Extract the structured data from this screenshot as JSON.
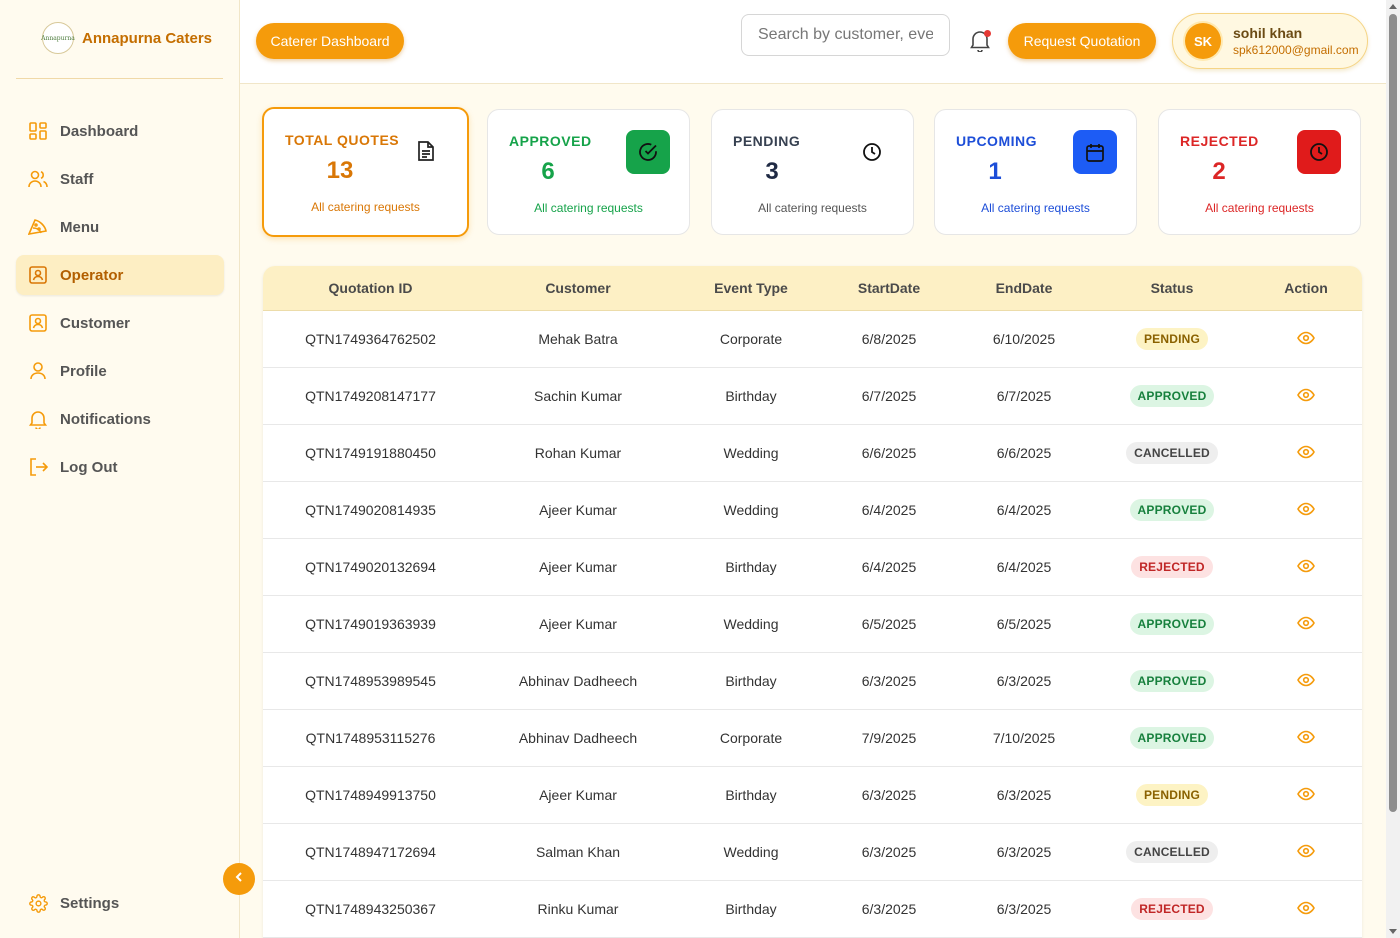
{
  "brand": {
    "name": "Annapurna Caters",
    "logo_text": "Annapurna"
  },
  "sidebar": {
    "items": [
      {
        "label": "Dashboard",
        "icon": "grid-icon"
      },
      {
        "label": "Staff",
        "icon": "users-icon"
      },
      {
        "label": "Menu",
        "icon": "pizza-icon"
      },
      {
        "label": "Operator",
        "icon": "id-card-icon",
        "active": true
      },
      {
        "label": "Customer",
        "icon": "id-card-icon"
      },
      {
        "label": "Profile",
        "icon": "user-icon"
      },
      {
        "label": "Notifications",
        "icon": "bell-icon"
      },
      {
        "label": "Log Out",
        "icon": "logout-icon"
      }
    ],
    "settings_label": "Settings"
  },
  "header": {
    "dashboard_button": "Caterer Dashboard",
    "search_placeholder": "Search by customer, event",
    "request_button": "Request Quotation",
    "user": {
      "initials": "SK",
      "name": "sohil khan",
      "email": "spk612000@gmail.com"
    }
  },
  "stats": [
    {
      "title": "TOTAL QUOTES",
      "value": "13",
      "sub": "All catering requests",
      "color": "#d97706",
      "icon": "document-icon"
    },
    {
      "title": "APPROVED",
      "value": "6",
      "sub": "All catering requests",
      "color": "#16a34a",
      "icon": "check-circle-icon"
    },
    {
      "title": "PENDING",
      "value": "3",
      "sub": "All catering requests",
      "color": "#374151",
      "icon": "clock-icon"
    },
    {
      "title": "UPCOMING",
      "value": "1",
      "sub": "All catering requests",
      "color": "#1d4ed8",
      "icon": "calendar-icon"
    },
    {
      "title": "REJECTED",
      "value": "2",
      "sub": "All catering requests",
      "color": "#dc2626",
      "icon": "clock-icon"
    }
  ],
  "table": {
    "columns": [
      "Quotation ID",
      "Customer",
      "Event Type",
      "StartDate",
      "EndDate",
      "Status",
      "Action"
    ],
    "rows": [
      {
        "id": "QTN1749364762502",
        "customer": "Mehak Batra",
        "event": "Corporate",
        "start": "6/8/2025",
        "end": "6/10/2025",
        "status": "PENDING"
      },
      {
        "id": "QTN1749208147177",
        "customer": "Sachin Kumar",
        "event": "Birthday",
        "start": "6/7/2025",
        "end": "6/7/2025",
        "status": "APPROVED"
      },
      {
        "id": "QTN1749191880450",
        "customer": "Rohan Kumar",
        "event": "Wedding",
        "start": "6/6/2025",
        "end": "6/6/2025",
        "status": "CANCELLED"
      },
      {
        "id": "QTN1749020814935",
        "customer": "Ajeer Kumar",
        "event": "Wedding",
        "start": "6/4/2025",
        "end": "6/4/2025",
        "status": "APPROVED"
      },
      {
        "id": "QTN1749020132694",
        "customer": "Ajeer Kumar",
        "event": "Birthday",
        "start": "6/4/2025",
        "end": "6/4/2025",
        "status": "REJECTED"
      },
      {
        "id": "QTN1749019363939",
        "customer": "Ajeer Kumar",
        "event": "Wedding",
        "start": "6/5/2025",
        "end": "6/5/2025",
        "status": "APPROVED"
      },
      {
        "id": "QTN1748953989545",
        "customer": "Abhinav Dadheech",
        "event": "Birthday",
        "start": "6/3/2025",
        "end": "6/3/2025",
        "status": "APPROVED"
      },
      {
        "id": "QTN1748953115276",
        "customer": "Abhinav Dadheech",
        "event": "Corporate",
        "start": "7/9/2025",
        "end": "7/10/2025",
        "status": "APPROVED"
      },
      {
        "id": "QTN1748949913750",
        "customer": "Ajeer Kumar",
        "event": "Birthday",
        "start": "6/3/2025",
        "end": "6/3/2025",
        "status": "PENDING"
      },
      {
        "id": "QTN1748947172694",
        "customer": "Salman Khan",
        "event": "Wedding",
        "start": "6/3/2025",
        "end": "6/3/2025",
        "status": "CANCELLED"
      },
      {
        "id": "QTN1748943250367",
        "customer": "Rinku Kumar",
        "event": "Birthday",
        "start": "6/3/2025",
        "end": "6/3/2025",
        "status": "REJECTED"
      }
    ]
  },
  "colors": {
    "accent": "#f59b0b",
    "brand": "#c46e00"
  }
}
